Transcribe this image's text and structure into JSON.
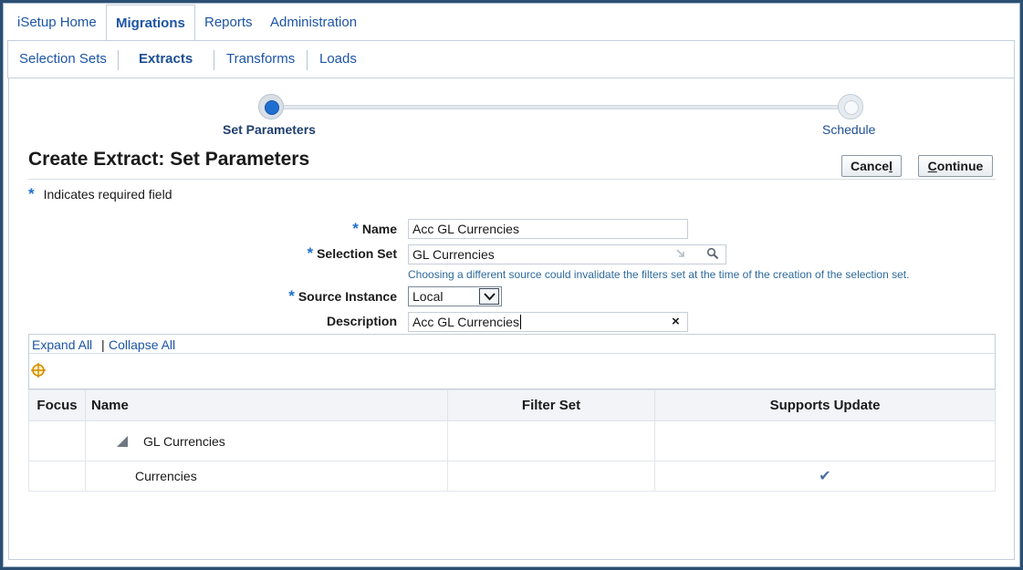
{
  "top_tabs": [
    {
      "label": "iSetup Home"
    },
    {
      "label": "Migrations",
      "active": true
    },
    {
      "label": "Reports"
    },
    {
      "label": "Administration"
    }
  ],
  "subnav": [
    {
      "label": "Selection Sets"
    },
    {
      "label": "Extracts",
      "active": true
    },
    {
      "label": "Transforms"
    },
    {
      "label": "Loads"
    }
  ],
  "train": {
    "steps": [
      {
        "label": "Set Parameters",
        "state": "current"
      },
      {
        "label": "Schedule",
        "state": "upcoming"
      }
    ]
  },
  "page": {
    "title": "Create Extract: Set Parameters",
    "cancel_label_pre": "Cance",
    "cancel_label_ul": "l",
    "continue_label_ul": "C",
    "continue_label_post": "ontinue",
    "required_star": "*",
    "required_note": "Indicates required field"
  },
  "form": {
    "name_label": "Name",
    "name_value": "Acc GL Currencies",
    "selection_set_label": "Selection Set",
    "selection_set_value": "GL Currencies",
    "selection_set_hint": "Choosing a different source could invalidate the filters set at the time of the creation of the selection set.",
    "source_instance_label": "Source Instance",
    "source_instance_value": "Local",
    "description_label": "Description",
    "description_value": "Acc GL Currencies",
    "star": "*"
  },
  "tree_toolbar": {
    "expand_all": "Expand All",
    "separator": "|",
    "collapse_all": "Collapse All"
  },
  "table": {
    "headers": {
      "focus": "Focus",
      "name": "Name",
      "filter_set": "Filter Set",
      "supports_update": "Supports Update"
    },
    "rows": [
      {
        "name": "GL Currencies",
        "filter_set": "",
        "supports_update": false,
        "expandable": true
      },
      {
        "name": "Currencies",
        "filter_set": "",
        "supports_update": true
      }
    ],
    "check_glyph": "✔"
  },
  "colors": {
    "link": "#1d55a5",
    "accent": "#1f6fd1",
    "frame": "#2b4f72"
  }
}
